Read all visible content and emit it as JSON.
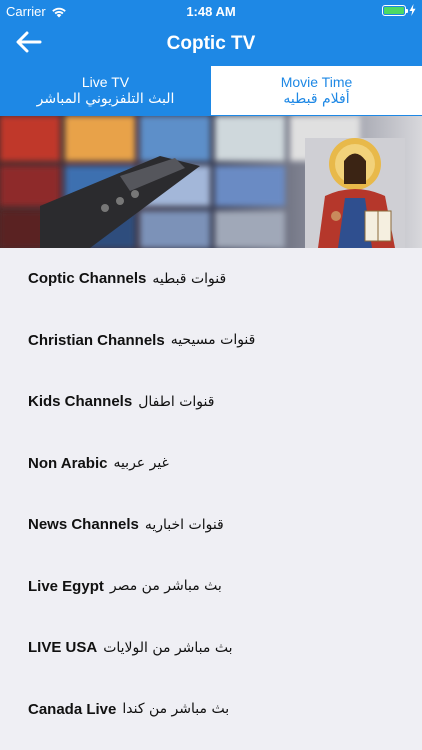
{
  "status_bar": {
    "carrier": "Carrier",
    "time": "1:48 AM",
    "icons": [
      "wifi-icon",
      "battery-icon",
      "charging-bolt-icon"
    ]
  },
  "nav": {
    "title": "Coptic TV",
    "back_icon": "back-arrow-icon"
  },
  "tabs": [
    {
      "label": "Live TV",
      "sublabel": "البث التلفزيوني المباشر",
      "active": true
    },
    {
      "label": "Movie Time",
      "sublabel": "أفلام قبطيه",
      "active": false
    }
  ],
  "banner": {
    "description_icons": [
      "tv-wall-image",
      "remote-control-image",
      "christ-icon-image"
    ]
  },
  "channels": [
    {
      "en": "Coptic Channels",
      "ar": "قنوات قبطيه"
    },
    {
      "en": "Christian Channels",
      "ar": "قنوات مسيحيه"
    },
    {
      "en": "Kids Channels",
      "ar": "قنوات اطفال"
    },
    {
      "en": "Non Arabic",
      "ar": "غير عربيه"
    },
    {
      "en": "News Channels",
      "ar": "قنوات اخباريه"
    },
    {
      "en": "Live Egypt",
      "ar": "بث مباشر من مصر"
    },
    {
      "en": "LIVE USA",
      "ar": "بث مباشر من الولايات"
    },
    {
      "en": "Canada Live",
      "ar": "بث مباشر من كندا"
    }
  ],
  "colors": {
    "primary": "#1e88e5",
    "background": "#efeff4",
    "battery": "#4cd964"
  }
}
